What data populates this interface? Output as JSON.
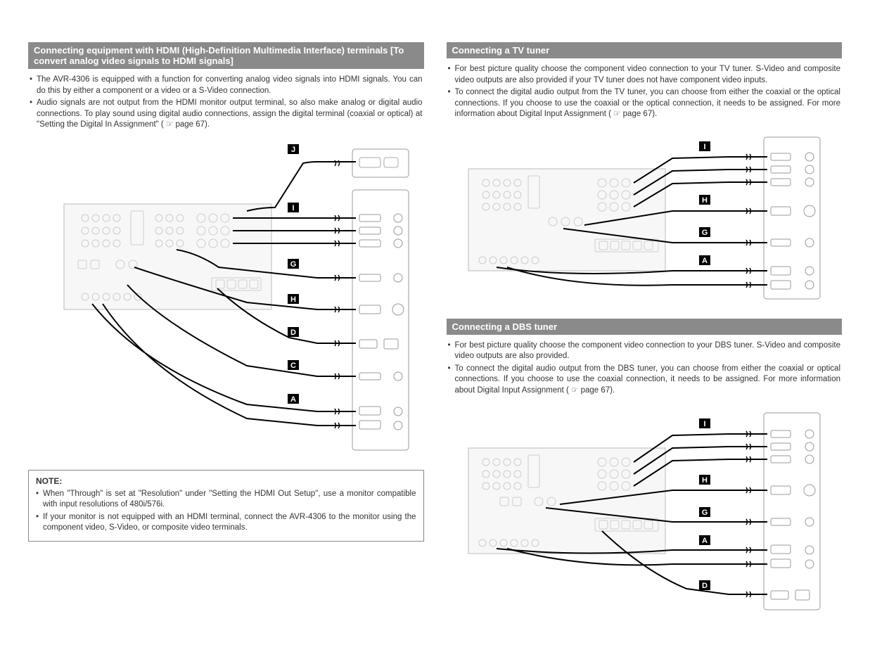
{
  "left": {
    "header": "Connecting equipment with HDMI (High-Definition Multimedia Interface) terminals [To convert analog video signals to HDMI signals]",
    "bullets": [
      "The AVR-4306 is equipped with a function for converting analog video signals into HDMI signals. You can do this by either a component or a video or a S-Video connection.",
      "Audio signals are not output from the HDMI monitor output terminal, so also make analog or digital audio connections. To play sound using digital audio connections, assign the digital terminal (coaxial or optical) at \"Setting the Digital In Assignment\" ( ☞ page 67)."
    ],
    "note_title": "NOTE:",
    "note_bullets": [
      "When \"Through\" is set at \"Resolution\" under \"Setting the HDMI Out Setup\", use a monitor compatible with input resolutions of 480i/576i.",
      "If your monitor is not equipped with an HDMI terminal, connect the AVR-4306 to the monitor using the component video, S-Video, or composite video terminals."
    ],
    "diagram_labels": [
      "J",
      "I",
      "G",
      "H",
      "D",
      "C",
      "A"
    ]
  },
  "right_top": {
    "header": "Connecting a TV tuner",
    "bullets": [
      "For best picture quality choose the component video connection to your TV tuner. S-Video and composite video outputs are also provided if your TV tuner does not have component video inputs.",
      "To connect the digital audio output from the TV tuner, you can choose from either the coaxial or the optical connections. If you choose to use the coaxial or the optical connection, it needs to be assigned. For more information about Digital Input Assignment ( ☞ page 67)."
    ],
    "diagram_labels": [
      "I",
      "H",
      "G",
      "A"
    ]
  },
  "right_bottom": {
    "header": "Connecting a DBS tuner",
    "bullets": [
      "For best picture quality choose the component video connection to your DBS tuner. S-Video and composite video outputs are also provided.",
      "To connect the digital audio output from the DBS tuner, you can choose from either the coaxial or optical connections. If you choose to use the coaxial connection, it needs to be assigned. For more information about Digital Input Assignment ( ☞ page 67)."
    ],
    "diagram_labels": [
      "I",
      "H",
      "G",
      "A",
      "D"
    ]
  }
}
